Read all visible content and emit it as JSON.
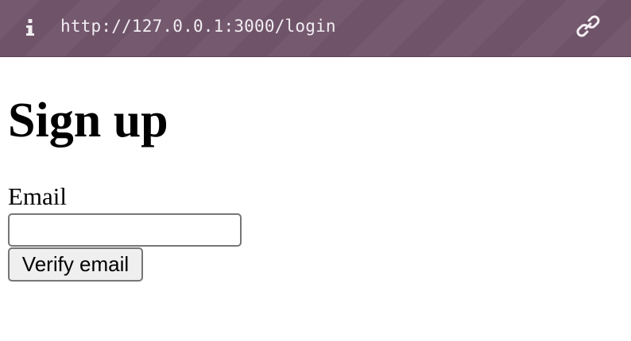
{
  "browser": {
    "url": "http://127.0.0.1:3000/login",
    "info_icon": "info-icon",
    "link_icon": "link-icon",
    "bar_color": "#74596f"
  },
  "page": {
    "title": "Sign up",
    "email_label": "Email",
    "email_value": "",
    "email_placeholder": "",
    "verify_button_label": "Verify email"
  }
}
